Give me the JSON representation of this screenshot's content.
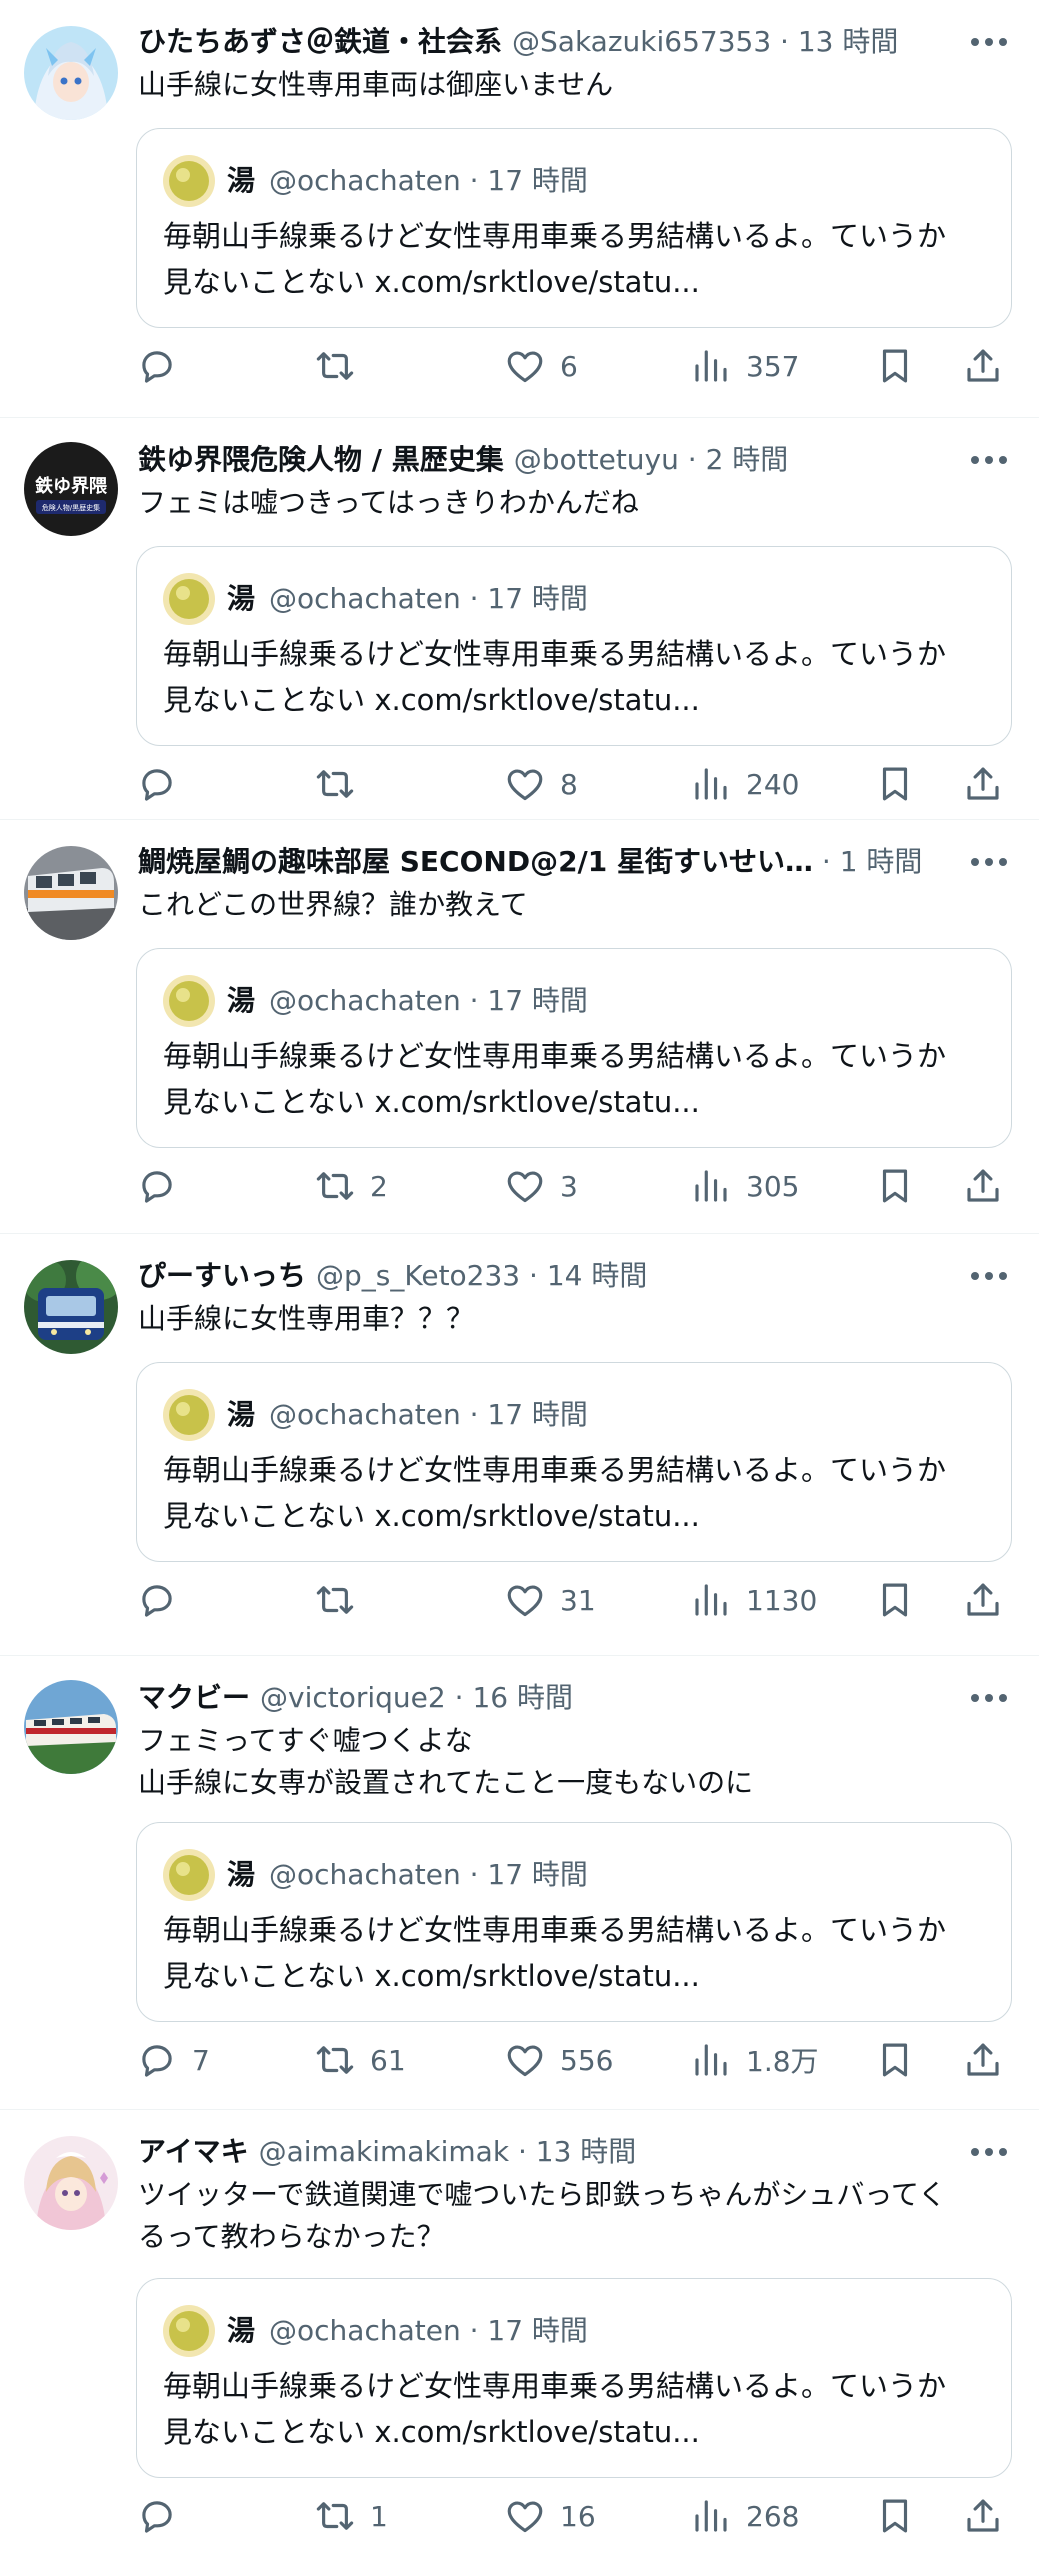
{
  "quoted": {
    "name": "湯",
    "handle": "@ochachaten",
    "time": "17 時間",
    "line1": "毎朝山手線乗るけど女性専用車乗る男結構いるよ。ていうか",
    "line2": "見ないことない x.com/srktlove/statu..."
  },
  "tweets": [
    {
      "name": "ひたちあずさ＠鉄道・社会系",
      "handle": "@Sakazuki657353",
      "time": "13 時間",
      "text": "山手線に女性専用車両は御座いません",
      "reply_count": "",
      "retweet_count": "",
      "like_count": "6",
      "view_count": "357"
    },
    {
      "name": "鉄ゆ界隈危険人物 / 黒歴史集",
      "handle": "@bottetuyu",
      "time": "2 時間",
      "text": "フェミは嘘つきってはっきりわかんだね",
      "avatar_text": "鉄ゆ界隈",
      "avatar_sub": "危険人物/黒歴史集",
      "reply_count": "",
      "retweet_count": "",
      "like_count": "8",
      "view_count": "240"
    },
    {
      "name": "鯛焼屋鯛の趣味部屋 SECOND@2/1 星街すいせい…",
      "handle": "",
      "time": "1 時間",
      "text": "これどこの世界線？誰か教えて",
      "reply_count": "",
      "retweet_count": "2",
      "like_count": "3",
      "view_count": "305"
    },
    {
      "name": "ぴーすいっち",
      "handle": "@p_s_Keto233",
      "time": "14 時間",
      "text": "山手線に女性専用車？？？",
      "reply_count": "",
      "retweet_count": "",
      "like_count": "31",
      "view_count": "1130"
    },
    {
      "name": "マクビー",
      "handle": "@victorique2",
      "time": "16 時間",
      "text": "フェミってすぐ嘘つくよな\n山手線に女専が設置されてたこと一度もないのに",
      "reply_count": "7",
      "retweet_count": "61",
      "like_count": "556",
      "view_count": "1.8万"
    },
    {
      "name": "アイマキ",
      "handle": "@aimakimakimak",
      "time": "13 時間",
      "text": "ツイッターで鉄道関連で嘘ついたら即鉄っちゃんがシュバってく\nるって教わらなかった？",
      "reply_count": "",
      "retweet_count": "1",
      "like_count": "16",
      "view_count": "268"
    }
  ],
  "colors": {
    "text_primary": "#0f1419",
    "text_secondary": "#536471",
    "border": "#cfd9de",
    "divider": "#eff3f4"
  },
  "icons": [
    "more-dots-icon",
    "reply-icon",
    "retweet-icon",
    "heart-icon",
    "views-icon",
    "bookmark-icon",
    "share-icon"
  ]
}
